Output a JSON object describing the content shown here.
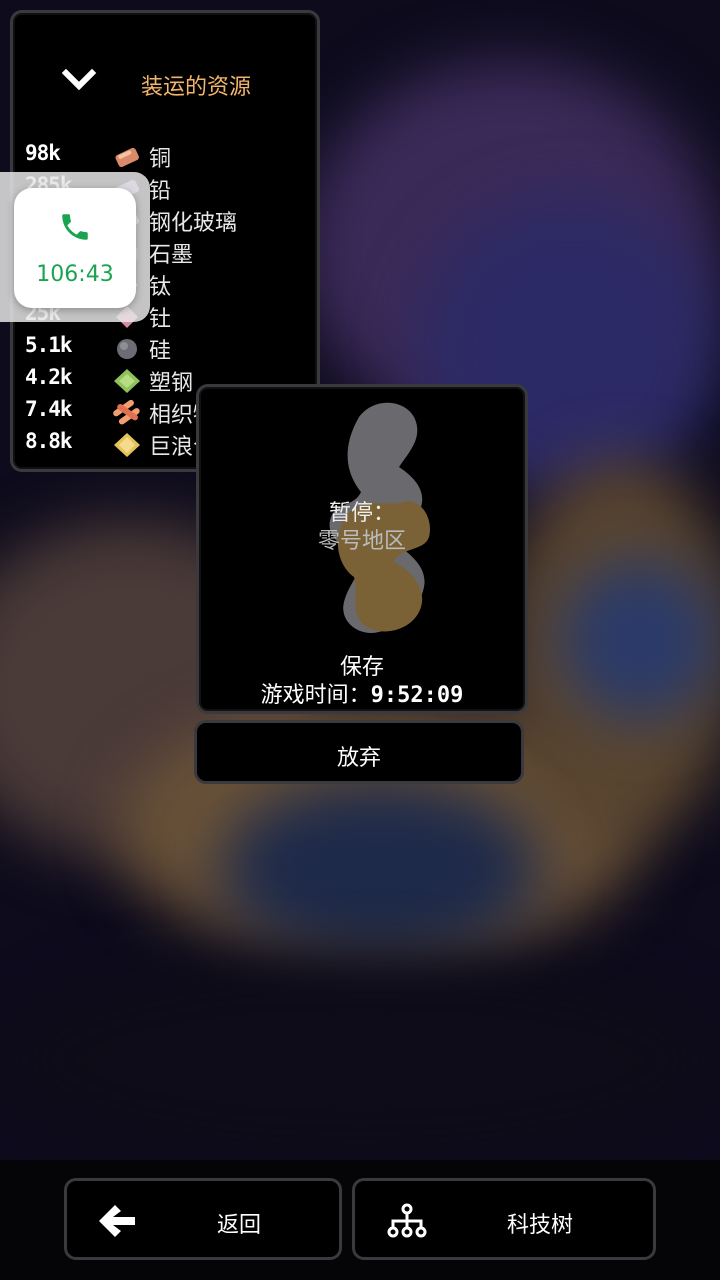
{
  "resources_panel": {
    "title": "装运的资源",
    "items": [
      {
        "value": "98k",
        "name": "铜",
        "icon": "copper-icon",
        "color": "#d98a68"
      },
      {
        "value": "285k",
        "name": "铅",
        "icon": "lead-icon",
        "color": "#a88cc8"
      },
      {
        "value": "",
        "name": "钢化玻璃",
        "icon": "metaglass-icon",
        "color": "#d9a0b8"
      },
      {
        "value": "",
        "name": "石墨",
        "icon": "graphite-icon",
        "color": "#555a70"
      },
      {
        "value": "",
        "name": "钛",
        "icon": "titanium-icon",
        "color": "#9a9ac8"
      },
      {
        "value": "25k",
        "name": "钍",
        "icon": "thorium-icon",
        "color": "#d88aa0"
      },
      {
        "value": "5.1k",
        "name": "硅",
        "icon": "silicon-icon",
        "color": "#6c6c74"
      },
      {
        "value": "4.2k",
        "name": "塑钢",
        "icon": "plastanium-icon",
        "color": "#8fc25c"
      },
      {
        "value": "7.4k",
        "name": "相织物",
        "icon": "phase-fabric-icon",
        "color": "#f0a070"
      },
      {
        "value": "8.8k",
        "name": "巨浪合金",
        "icon": "surge-alloy-icon",
        "color": "#e6c25a"
      }
    ]
  },
  "call_overlay": {
    "duration": "106:43",
    "icon": "phone-icon",
    "accent": "#1aa451"
  },
  "pause_panel": {
    "title": "暂停：",
    "zone": "零号地区",
    "save": "保存",
    "playtime_label": "游戏时间：",
    "playtime_value": "9:52:09"
  },
  "abandon_button": {
    "label": "放弃"
  },
  "bottom_buttons": {
    "back": {
      "label": "返回",
      "icon": "arrow-left-icon"
    },
    "tech_tree": {
      "label": "科技树",
      "icon": "tech-tree-icon"
    }
  }
}
